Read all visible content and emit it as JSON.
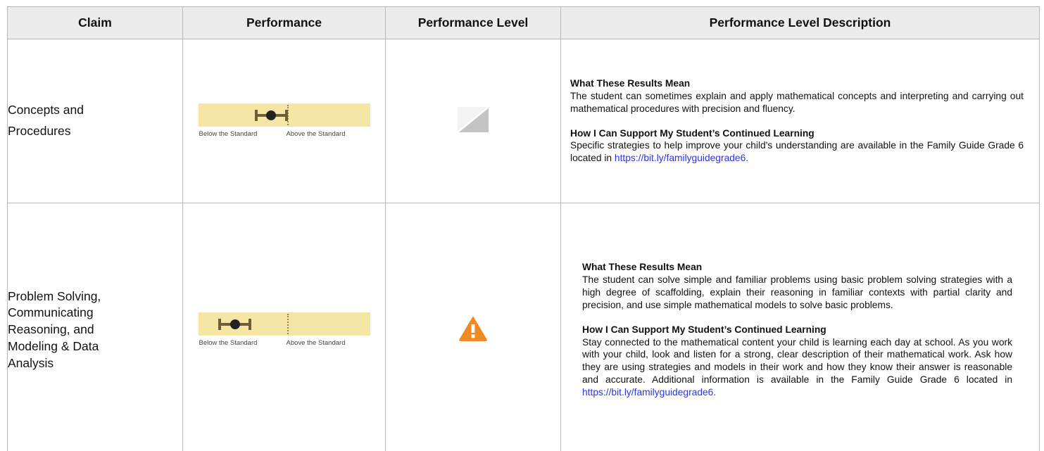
{
  "header": {
    "claim": "Claim",
    "performance": "Performance",
    "performance_level": "Performance Level",
    "performance_level_description": "Performance Level Description"
  },
  "scale_labels": {
    "below": "Below the Standard",
    "above": "Above the Standard"
  },
  "colors": {
    "scale_band": "#f6e6a6",
    "warning": "#f08a24",
    "link": "#2a36e6",
    "header_bg": "#ececec"
  },
  "rows": [
    {
      "claim_lines": [
        "Concepts and",
        "Procedures"
      ],
      "performance_level_icon": "near-standard-icon",
      "results_heading": "What These Results Mean",
      "results_text": "The student can sometimes explain and apply mathematical concepts and interpreting and carrying out mathematical procedures with precision and fluency.",
      "support_heading": "How I Can Support My Student’s Continued Learning",
      "support_text": "Specific strategies to help improve your child's understanding are available in the Family Guide Grade 6 located   in ",
      "support_link": "https://bit.ly/familyguidegrade6."
    },
    {
      "claim_lines": [
        "Problem Solving,",
        "Communicating",
        "Reasoning, and",
        "Modeling & Data",
        "Analysis"
      ],
      "performance_level_icon": "warning-icon",
      "results_heading": "What These Results Mean",
      "results_text": "The student can solve simple and familiar problems using basic problem solving strategies with a high degree of scaffolding, explain their reasoning in familiar contexts with partial clarity and precision, and use simple mathematical models to solve basic problems.",
      "support_heading": "How I Can Support My Student’s Continued Learning",
      "support_text": "Stay connected to the mathematical content your child is learning each day at school. As you work with your child, look and listen for a strong, clear description of their mathematical work. Ask how they are using strategies and models in their work and how they know their answer is reasonable and accurate.  Additional information is available in the Family Guide Grade 6 located in ",
      "support_link": "https://bit.ly/familyguidegrade6."
    }
  ]
}
